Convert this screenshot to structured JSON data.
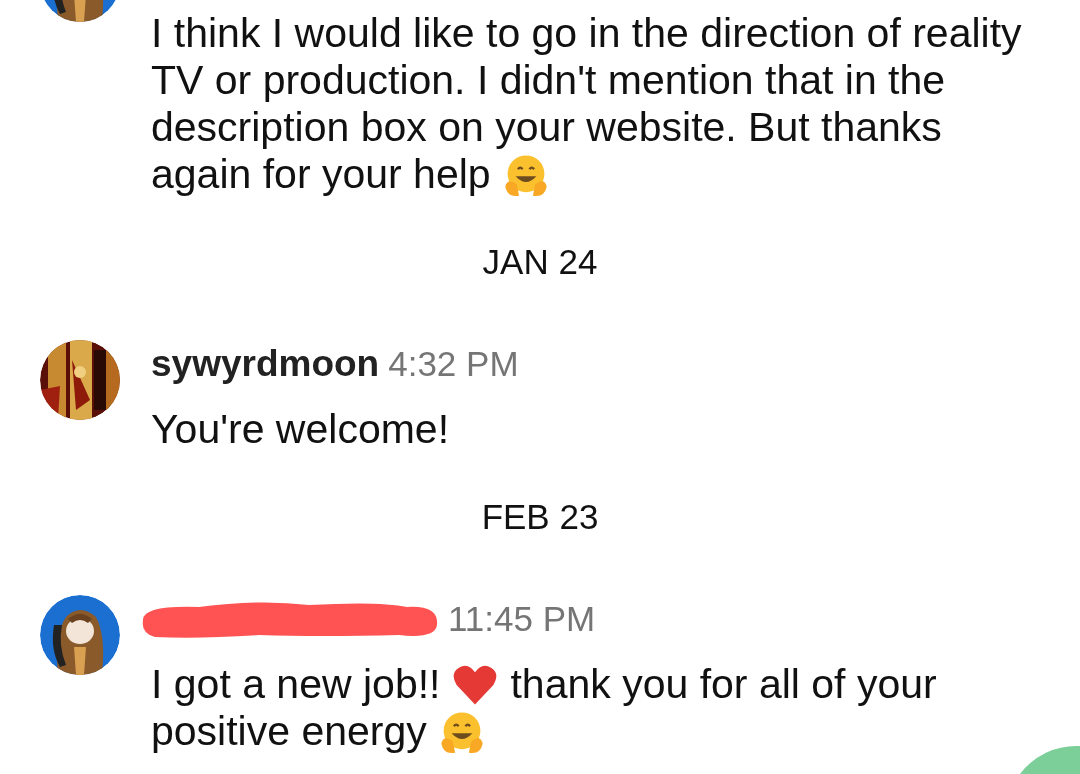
{
  "messages": [
    {
      "kind": "message",
      "lines": [
        [
          {
            "kind": "text",
            "text": "I think I would like to go in the direction of reality"
          }
        ],
        [
          {
            "kind": "text",
            "text": "TV or production. I didn't mention that in the"
          }
        ],
        [
          {
            "kind": "text",
            "text": "description box on your website. But thanks"
          }
        ],
        [
          {
            "kind": "text",
            "text": "again for your help"
          },
          {
            "kind": "hug"
          }
        ]
      ]
    },
    {
      "kind": "date",
      "text": "JAN 24"
    },
    {
      "kind": "message",
      "author": {
        "name": "sywyrdmoon",
        "redacted": false
      },
      "time": "4:32 PM",
      "lines": [
        [
          {
            "kind": "text",
            "text": "You're welcome!"
          }
        ]
      ]
    },
    {
      "kind": "date",
      "text": "FEB 23"
    },
    {
      "kind": "message",
      "author": {
        "redacted": true
      },
      "time": "11:45 PM",
      "lines": [
        [
          {
            "kind": "text",
            "text": "I got a new job!!"
          },
          {
            "kind": "heart"
          },
          {
            "kind": "text",
            "text": "thank you for all of your"
          }
        ],
        [
          {
            "kind": "text",
            "text": "positive energy"
          },
          {
            "kind": "hug"
          }
        ]
      ]
    }
  ]
}
